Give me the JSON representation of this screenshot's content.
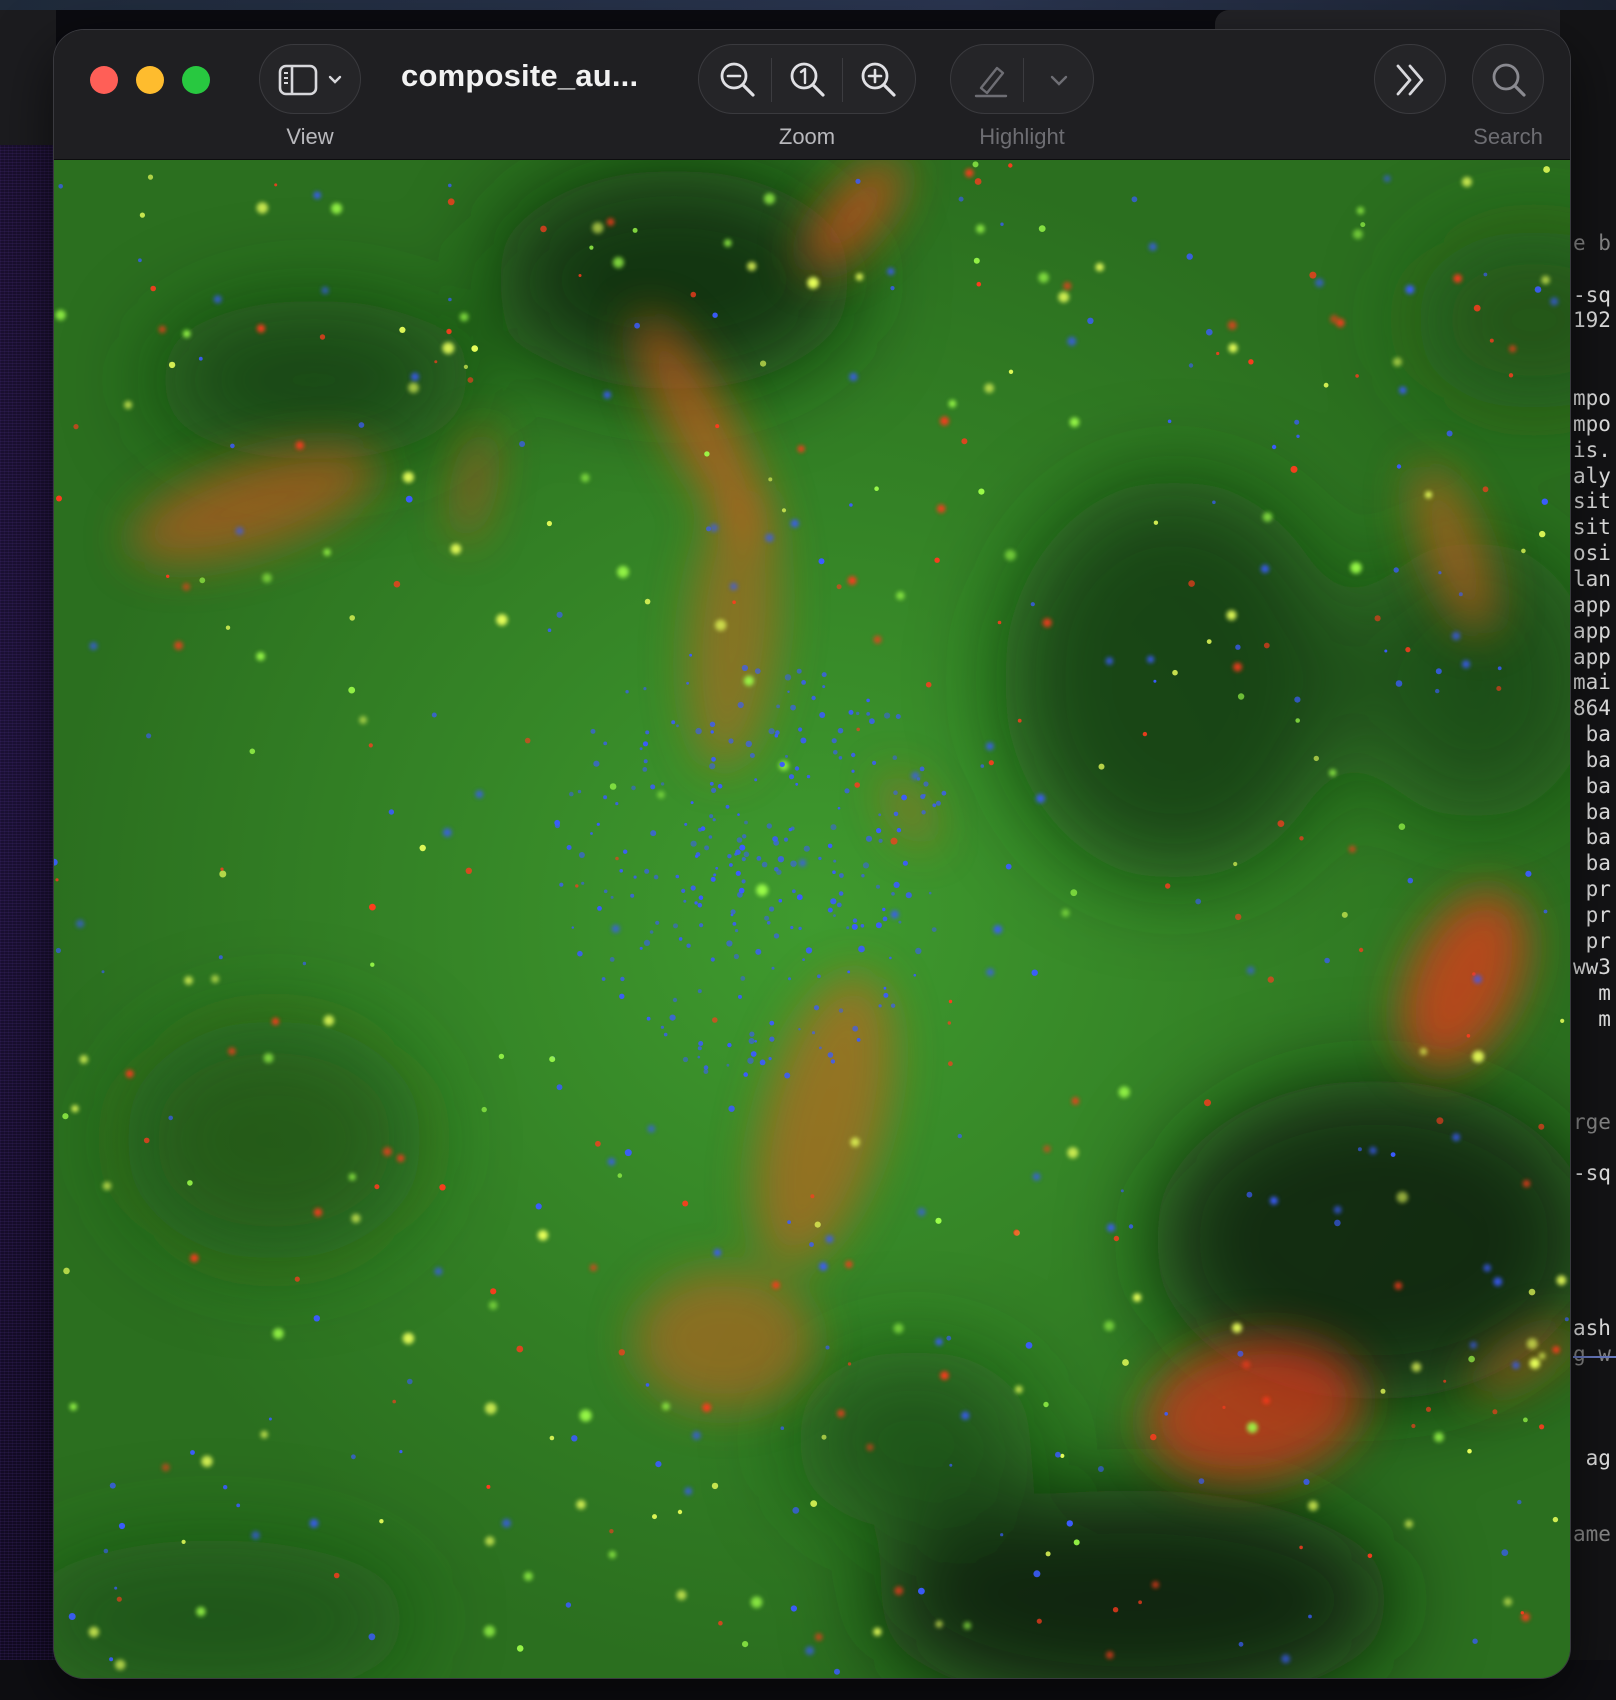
{
  "window": {
    "title": "composite_au...",
    "image_name": "astronomical-composite-image"
  },
  "toolbar": {
    "view_label": "View",
    "zoom_label": "Zoom",
    "highlight_label": "Highlight",
    "search_label": "Search",
    "icons": {
      "sidebar": "sidebar-icon",
      "zoom_out": "zoom-out-icon",
      "actual_size": "actual-size-icon",
      "zoom_in": "zoom-in-icon",
      "highlight": "highlighter-icon",
      "more": "chevron-double-right-icon",
      "search": "search-icon"
    }
  },
  "background_terminal": {
    "lines": [
      {
        "text": "e b",
        "dim": true
      },
      {
        "text": "-sq",
        "dim": false
      },
      {
        "text": "192",
        "dim": false
      },
      {
        "text": "mpo",
        "dim": false
      },
      {
        "text": "mpo",
        "dim": false
      },
      {
        "text": "is.",
        "dim": false
      },
      {
        "text": "aly",
        "dim": false
      },
      {
        "text": "sit",
        "dim": false
      },
      {
        "text": "sit",
        "dim": false
      },
      {
        "text": "osi",
        "dim": false
      },
      {
        "text": "lan",
        "dim": false
      },
      {
        "text": "app",
        "dim": false
      },
      {
        "text": "app",
        "dim": false
      },
      {
        "text": "app",
        "dim": false
      },
      {
        "text": "mai",
        "dim": false
      },
      {
        "text": "864",
        "dim": false
      },
      {
        "text": " ba",
        "dim": false
      },
      {
        "text": " ba",
        "dim": false
      },
      {
        "text": " ba",
        "dim": false
      },
      {
        "text": " ba",
        "dim": false
      },
      {
        "text": " ba",
        "dim": false
      },
      {
        "text": " ba",
        "dim": false
      },
      {
        "text": " pr",
        "dim": false
      },
      {
        "text": " pr",
        "dim": false
      },
      {
        "text": " pr",
        "dim": false
      },
      {
        "text": "ww3",
        "dim": false
      },
      {
        "text": "  m",
        "dim": false
      },
      {
        "text": "  m",
        "dim": false
      },
      {
        "text": "rge",
        "dim": true
      },
      {
        "text": "-sq",
        "dim": false
      },
      {
        "text": "ash",
        "dim": false
      },
      {
        "text": "g w",
        "dim": true
      },
      {
        "text": " ag",
        "dim": false
      },
      {
        "text": "ame",
        "dim": true
      }
    ]
  },
  "colors": {
    "traffic_red": "#ff5f57",
    "traffic_yellow": "#febc2e",
    "traffic_green": "#28c840",
    "image_green": "#2e7d22",
    "star_blue": "#3b5cff",
    "star_red": "#ff3b1e",
    "star_yellow": "#e8ff5a"
  }
}
